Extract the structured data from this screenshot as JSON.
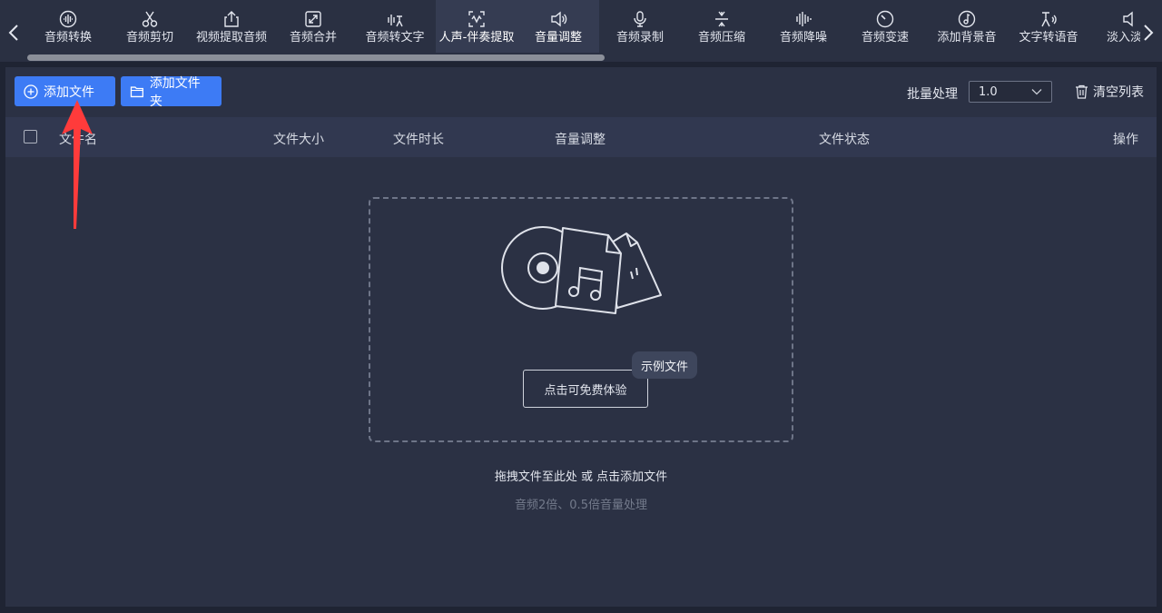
{
  "toolbar": {
    "tools": [
      {
        "label": "音频转换",
        "icon": "waveform-circle-icon"
      },
      {
        "label": "音频剪切",
        "icon": "scissors-icon"
      },
      {
        "label": "视频提取音频",
        "icon": "upload-box-icon"
      },
      {
        "label": "音频合并",
        "icon": "merge-arrows-icon"
      },
      {
        "label": "音频转文字",
        "icon": "voice-to-text-icon"
      },
      {
        "label": "人声-伴奏提取",
        "icon": "vocal-extract-icon",
        "active": true
      },
      {
        "label": "音量调整",
        "icon": "speaker-icon",
        "active": true
      },
      {
        "label": "音频录制",
        "icon": "microphone-icon"
      },
      {
        "label": "音频压缩",
        "icon": "compress-icon"
      },
      {
        "label": "音频降噪",
        "icon": "noise-bars-icon"
      },
      {
        "label": "音频变速",
        "icon": "speedometer-icon"
      },
      {
        "label": "添加背景音",
        "icon": "music-note-circle-icon"
      },
      {
        "label": "文字转语音",
        "icon": "text-to-speech-icon"
      },
      {
        "label": "淡入淡出",
        "icon": "fade-speaker-icon"
      }
    ]
  },
  "actions": {
    "add_file": "添加文件",
    "add_folder": "添加文件夹",
    "batch_label": "批量处理",
    "batch_value": "1.0",
    "clear_list": "清空列表"
  },
  "table": {
    "columns": [
      "文件名",
      "文件大小",
      "文件时长",
      "音量调整",
      "文件状态",
      "操作"
    ]
  },
  "dropzone": {
    "try_button": "点击可免费体验",
    "sample_badge": "示例文件",
    "hint_main": "拖拽文件至此处 或 点击添加文件",
    "hint_sub": "音频2倍、0.5倍音量处理"
  },
  "colors": {
    "background": "#1f2433",
    "panel": "#2b3144",
    "accent": "#3d7bf5",
    "annotation": "#ff3b3b"
  }
}
